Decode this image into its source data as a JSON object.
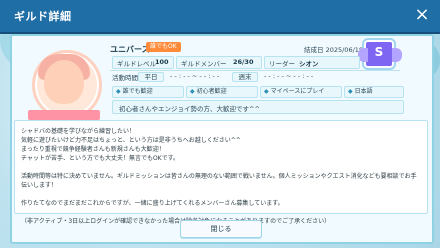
{
  "window": {
    "title": "ギルド詳細",
    "close_label": "×"
  },
  "guild": {
    "name": "ユニバース",
    "recruit_badge": "誰でもOK",
    "founded_label": "結成日",
    "founded_date": "2025/06/18",
    "rank": "S",
    "level_label": "ギルドレベル",
    "level_value": "100",
    "members_label": "ギルドメンバー",
    "members_value": "26/30",
    "leader_label": "リーダー",
    "leader_value": "シオン"
  },
  "activity": {
    "time_label": "活動時間",
    "weekday_label": "平日",
    "weekday_time": "- - : - - ~ - - : - -",
    "weekend_label": "週末",
    "weekend_time": "- - : - - ~ - - : - -",
    "tags": [
      {
        "icon": "user-icon",
        "label": "誰でも歓迎"
      },
      {
        "icon": "beginner-icon",
        "label": "初心者歓迎"
      },
      {
        "icon": "pace-icon",
        "label": "マイペースにプレイ"
      },
      {
        "icon": "language-icon",
        "label": "日本語"
      }
    ],
    "greeting": "初心者さんやエンジョイ勢の方、大歓迎です^^"
  },
  "description": {
    "text": "シャドバの基礎を学びながら練習したい！\n気軽に遊びたいけど力不足はちょっと、という方は是非うちへお越しください^^\nまったり重視で競争経験者さんも新規さんも大歓迎！\nチャットが苦手、という方でも大丈夫！無言でもOKです。\n\n活動時間等は特に決めていません。ギルドミッションは皆さんの無理のない範囲で戦いません。個人ミッションやクエスト消化なども要相談でお手伝いします！\n\n作りたてなのでまだまだこれからですが、一緒に盛り上げてくれるメンバーさん募集しています。\n\n（非アクティブ・3日以上ログインが確認できなかった場合は除名対象になることがありますのでご了承ください）"
  },
  "footer": {
    "close_button": "閉じる"
  },
  "colors": {
    "titlebar": "#1f6ea6",
    "accent": "#ff8b3a",
    "rank_purple": "#7f66f2"
  }
}
